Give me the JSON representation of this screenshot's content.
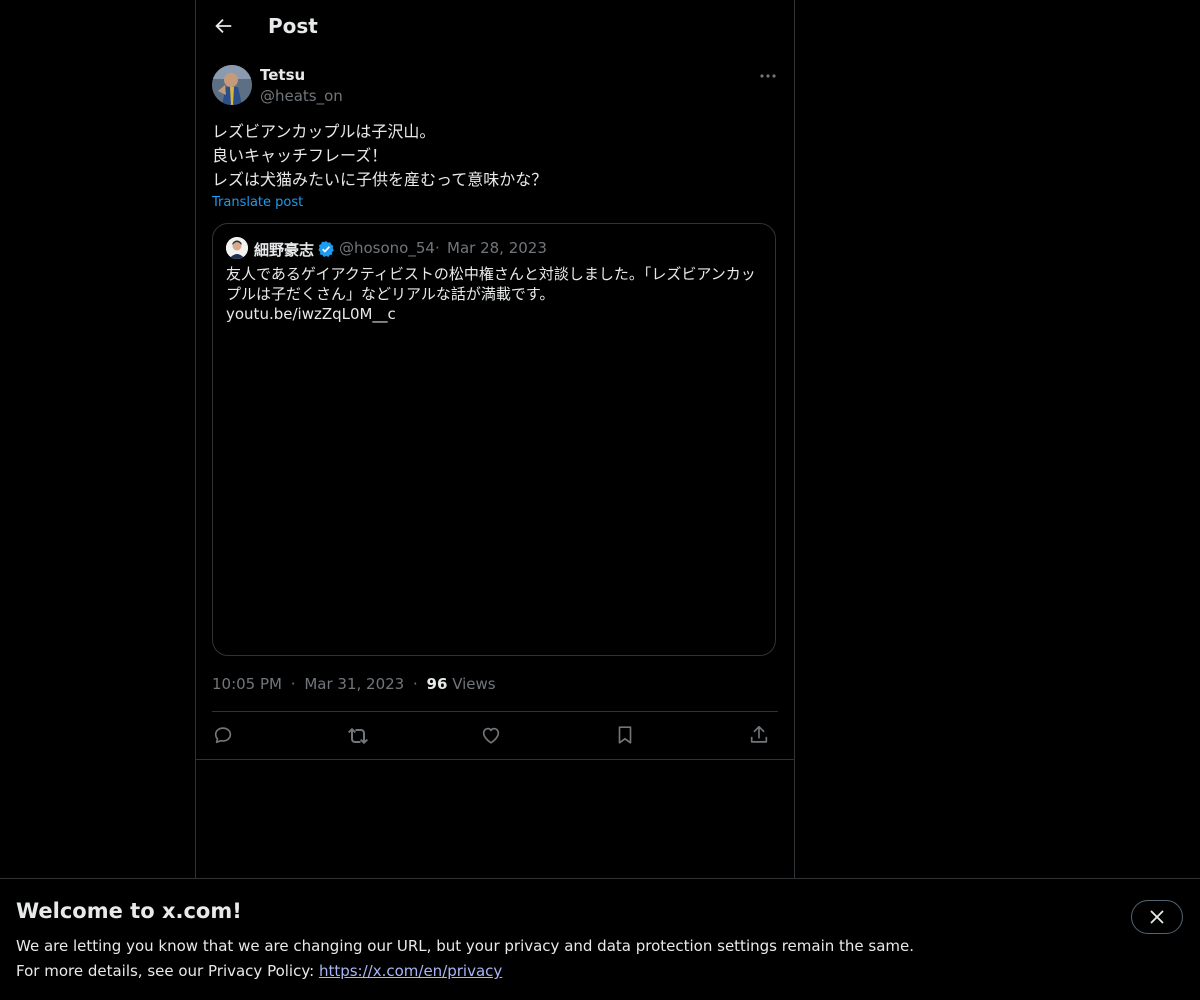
{
  "header": {
    "title": "Post"
  },
  "post": {
    "author_name": "Tetsu",
    "author_handle": "@heats_on",
    "lines": [
      "レズビアンカップルは子沢山。",
      "良いキャッチフレーズ！",
      "レズは犬猫みたいに子供を産むって意味かな？"
    ],
    "translate_label": "Translate post",
    "time": "10:05 PM",
    "date": "Mar 31, 2023",
    "views_count": "96",
    "views_label": "Views",
    "separator": "·"
  },
  "quote": {
    "author_name": "細野豪志",
    "author_handle": "@hosono_54",
    "date": "Mar 28, 2023",
    "text": "友人であるゲイアクティビストの松中権さんと対談しました。「レズビアンカップルは子だくさん」などリアルな話が満載です。",
    "link": "youtu.be/iwzZqL0M__c"
  },
  "colors": {
    "background": "#000000",
    "text": "#e7e9ea",
    "muted": "#71767b",
    "accent": "#1d9bf0",
    "border": "#2f3336"
  },
  "icons": {
    "back": "arrow-left-icon",
    "more": "ellipsis-icon",
    "verified": "verified-badge-icon",
    "reply": "reply-icon",
    "repost": "repost-icon",
    "like": "heart-icon",
    "bookmark": "bookmark-icon",
    "share": "share-icon",
    "close": "close-icon"
  },
  "banner": {
    "title": "Welcome to x.com!",
    "line1": "We are letting you know that we are changing our URL, but your privacy and data protection settings remain the same.",
    "line2_prefix": "For more details, see our Privacy Policy: ",
    "link": "https://x.com/en/privacy"
  }
}
